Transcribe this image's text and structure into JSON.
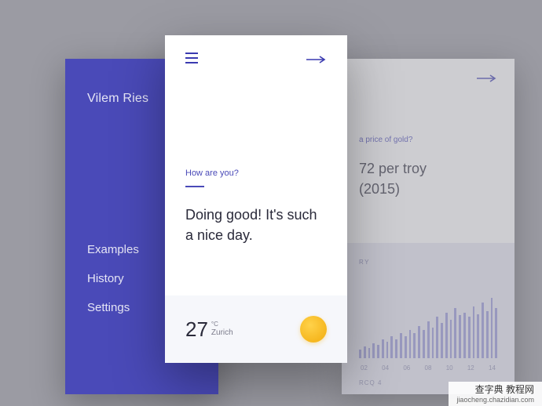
{
  "left": {
    "user": "Vilem Ries",
    "menu": [
      "Examples",
      "History",
      "Settings"
    ]
  },
  "center": {
    "prompt": "How are you?",
    "response": "Doing good! It's such a nice day.",
    "weather": {
      "temp": "27",
      "unit": "°C",
      "city": "Zurich"
    }
  },
  "right": {
    "question_fragment": "a price of gold?",
    "answer_line1": "72 per troy",
    "answer_line2": "(2015)",
    "chart_label": "RY",
    "rcq": "RCQ  4"
  },
  "chart_data": {
    "type": "bar",
    "title": "",
    "xlabel": "",
    "ylabel": "",
    "x_ticks": [
      "02",
      "04",
      "06",
      "08",
      "10",
      "12",
      "14"
    ],
    "values": [
      12,
      16,
      14,
      20,
      18,
      26,
      22,
      30,
      26,
      34,
      30,
      38,
      34,
      44,
      38,
      50,
      42,
      56,
      48,
      62,
      52,
      68,
      58,
      62,
      56,
      70,
      60,
      76,
      64,
      82,
      68
    ],
    "ylim": [
      0,
      100
    ]
  },
  "watermark": {
    "line1": "查字典 教程网",
    "line2": "jiaocheng.chazidian.com"
  }
}
